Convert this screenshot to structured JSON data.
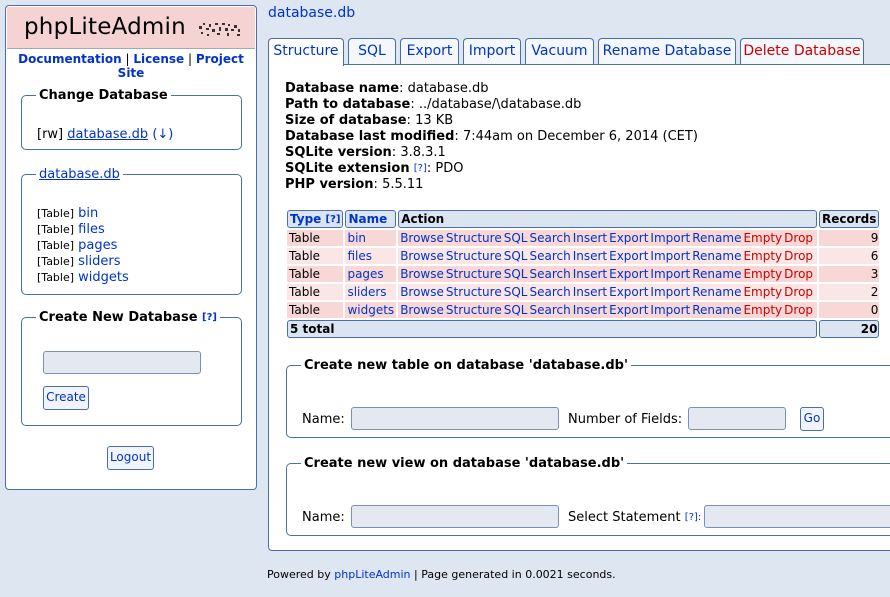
{
  "sidebar": {
    "logo_text": "phpLiteAdmin",
    "links": [
      "Documentation",
      "License",
      "Project Site"
    ],
    "change_db": {
      "legend": "Change Database",
      "mode": "[rw]",
      "db_name": "database.db",
      "arrow": "(↓)"
    },
    "current_db": {
      "legend": "database.db",
      "tag": "[Table]",
      "tables": [
        "bin",
        "files",
        "pages",
        "sliders",
        "widgets"
      ]
    },
    "create_db": {
      "legend": "Create New Database",
      "help": "[?]",
      "input_value": "",
      "button": "Create"
    },
    "logout": "Logout"
  },
  "breadcrumb": "database.db",
  "tabs": [
    "Structure",
    "SQL",
    "Export",
    "Import",
    "Vacuum",
    "Rename Database",
    "Delete Database"
  ],
  "info": [
    {
      "key": "Database name",
      "value": "database.db"
    },
    {
      "key": "Path to database",
      "value": "../database/\\database.db"
    },
    {
      "key": "Size of database",
      "value": "13 KB"
    },
    {
      "key": "Database last modified",
      "value": "7:44am on December 6, 2014 (CET)"
    },
    {
      "key": "SQLite version",
      "value": "3.8.3.1"
    },
    {
      "key": "SQLite extension",
      "help": "[?]",
      "value": "PDO"
    },
    {
      "key": "PHP version",
      "value": "5.5.11"
    }
  ],
  "table": {
    "headers": {
      "type": "Type",
      "type_help": "[?]",
      "name": "Name",
      "action": "Action",
      "records": "Records"
    },
    "actions": [
      "Browse",
      "Structure",
      "SQL",
      "Search",
      "Insert",
      "Export",
      "Import",
      "Rename"
    ],
    "danger_actions": [
      "Empty",
      "Drop"
    ],
    "rows": [
      {
        "type": "Table",
        "name": "bin",
        "records": "9"
      },
      {
        "type": "Table",
        "name": "files",
        "records": "6"
      },
      {
        "type": "Table",
        "name": "pages",
        "records": "3"
      },
      {
        "type": "Table",
        "name": "sliders",
        "records": "2"
      },
      {
        "type": "Table",
        "name": "widgets",
        "records": "0"
      }
    ],
    "total_label": "5 total",
    "total_records": "20"
  },
  "create_table": {
    "legend": "Create new table on database 'database.db'",
    "name_label": "Name:",
    "fields_label": "Number of Fields:",
    "button": "Go"
  },
  "create_view": {
    "legend": "Create new view on database 'database.db'",
    "name_label": "Name:",
    "select_label": "Select Statement",
    "help": "[?]:"
  },
  "footer": {
    "prefix": "Powered by ",
    "link": "phpLiteAdmin",
    "suffix": " | Page generated in 0.0021 seconds."
  },
  "colors": {
    "accent": "#03c",
    "danger": "#c00",
    "background": "#dde6f1",
    "logo_bg": "#f6d3d3",
    "border": "#4a6fa8"
  }
}
